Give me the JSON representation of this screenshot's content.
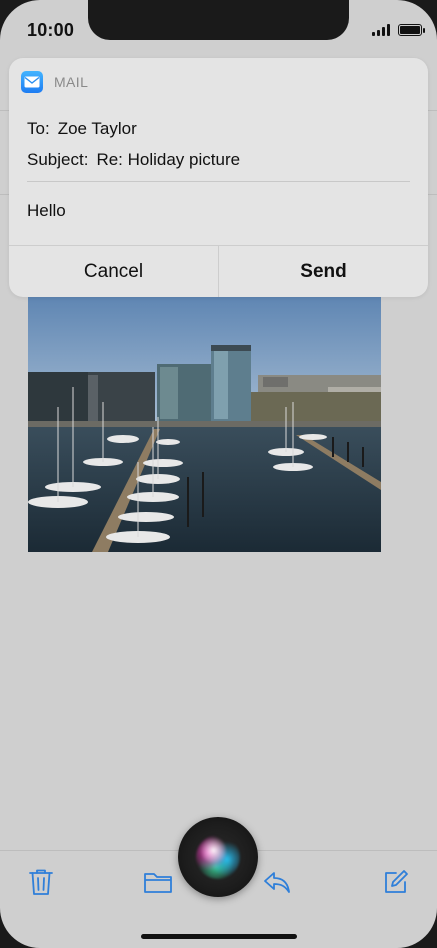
{
  "status": {
    "time": "10:00"
  },
  "card": {
    "app_name": "MAIL",
    "to_label": "To:",
    "to_value": "Zoe Taylor",
    "subject_label": "Subject:",
    "subject_value": "Re: Holiday picture",
    "body": "Hello",
    "cancel_label": "Cancel",
    "send_label": "Send"
  },
  "toolbar": {
    "icons": [
      "trash-icon",
      "folder-icon",
      "reply-icon",
      "compose-icon"
    ]
  },
  "colors": {
    "accent": "#2f7fd9",
    "card_bg": "#e4e4e4",
    "screen_bg": "#cfcfcf"
  }
}
